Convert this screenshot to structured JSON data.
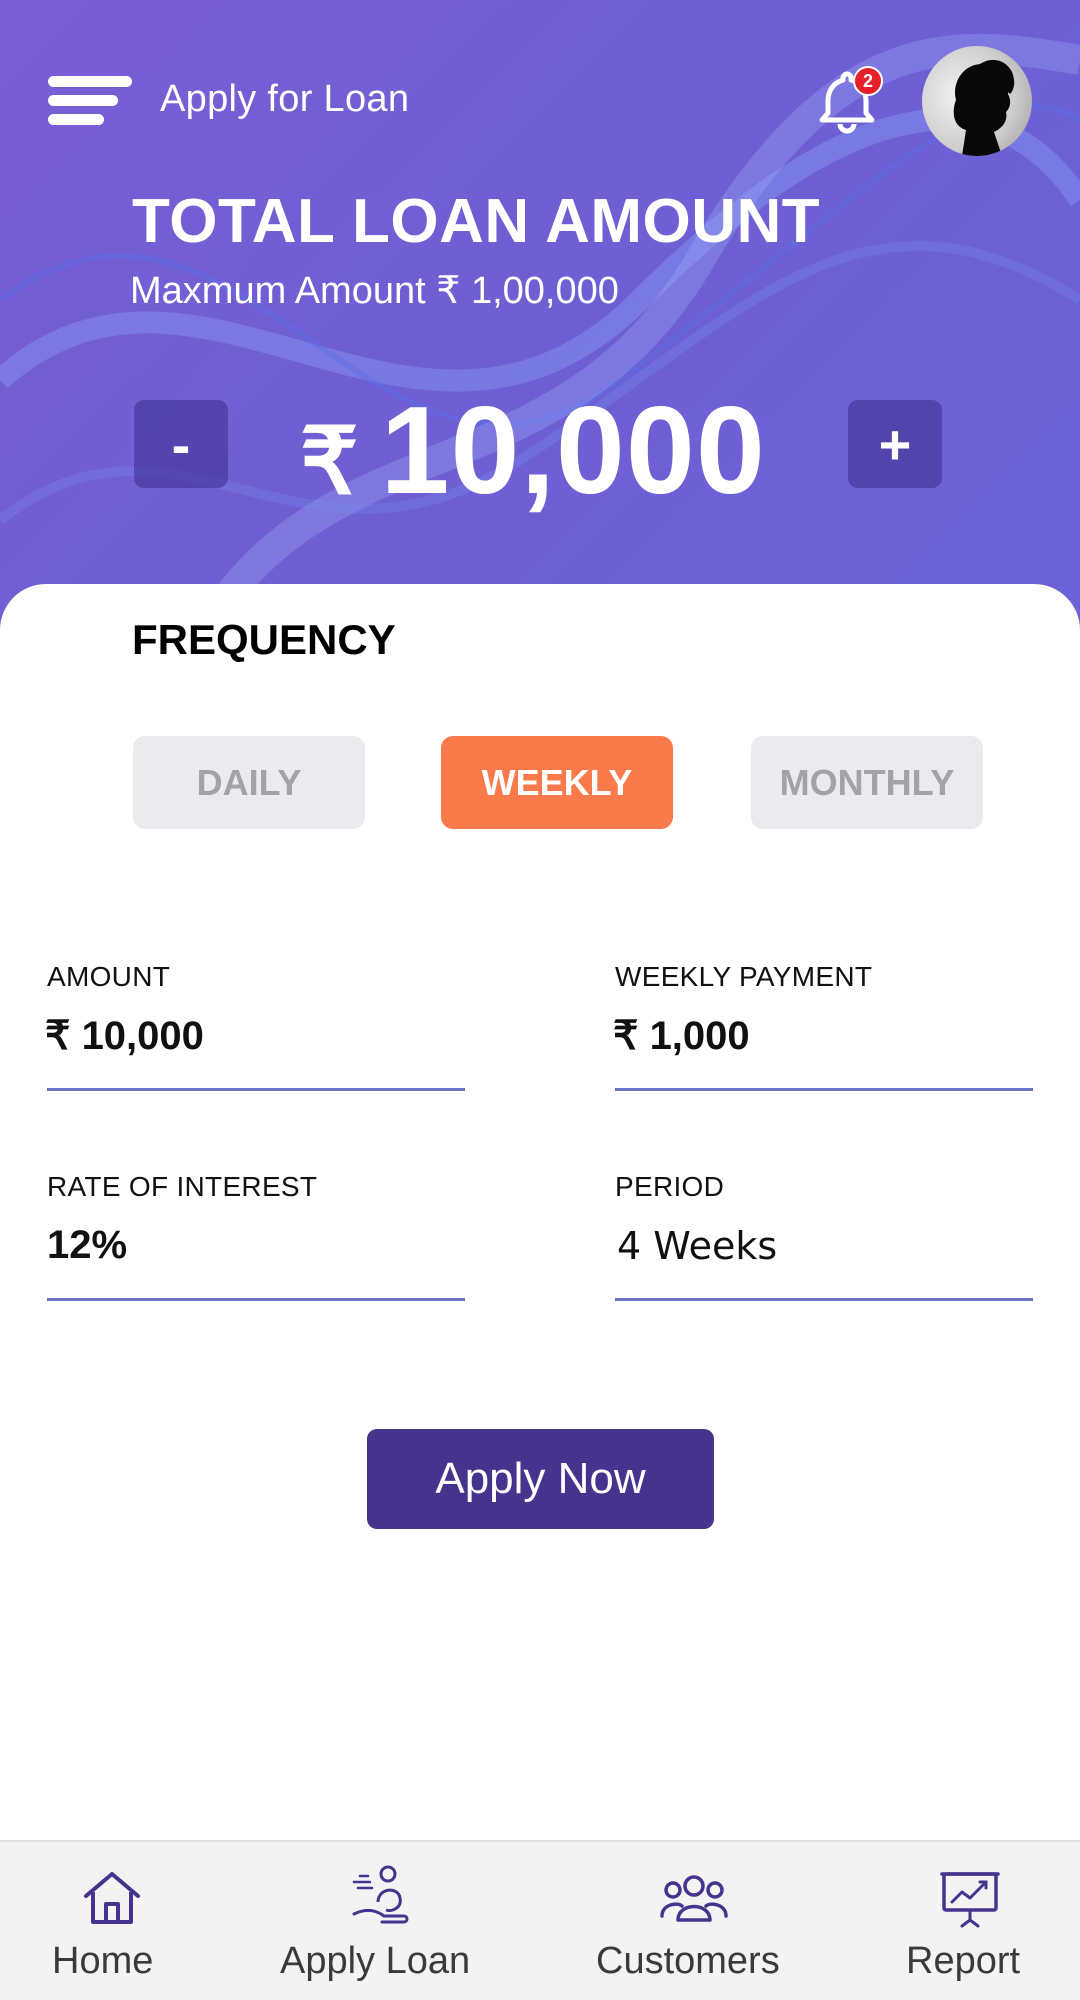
{
  "header": {
    "title": "Apply for Loan",
    "notification_count": "2"
  },
  "loan": {
    "heading": "TOTAL LOAN AMOUNT",
    "max_label": "Maxmum Amount ₹ 1,00,000",
    "currency_symbol": "₹",
    "amount": "10,000",
    "minus_label": "-",
    "plus_label": "+"
  },
  "frequency": {
    "heading": "FREQUENCY",
    "options": [
      "DAILY",
      "WEEKLY",
      "MONTHLY"
    ],
    "selected": "WEEKLY"
  },
  "fields": {
    "amount_label": "AMOUNT",
    "amount_value": "₹ 10,000",
    "payment_label": "WEEKLY PAYMENT",
    "payment_value": "₹ 1,000",
    "rate_label": "RATE OF INTEREST",
    "rate_value": "12%",
    "period_label": "PERIOD",
    "period_value": "4 Weeks"
  },
  "apply_button": "Apply Now",
  "nav": {
    "items": [
      "Home",
      "Apply Loan",
      "Customers",
      "Report"
    ]
  },
  "colors": {
    "hero": "#7060d5",
    "accent": "#fb7a4c",
    "primary": "#46338e",
    "underline": "#6d72c9"
  }
}
